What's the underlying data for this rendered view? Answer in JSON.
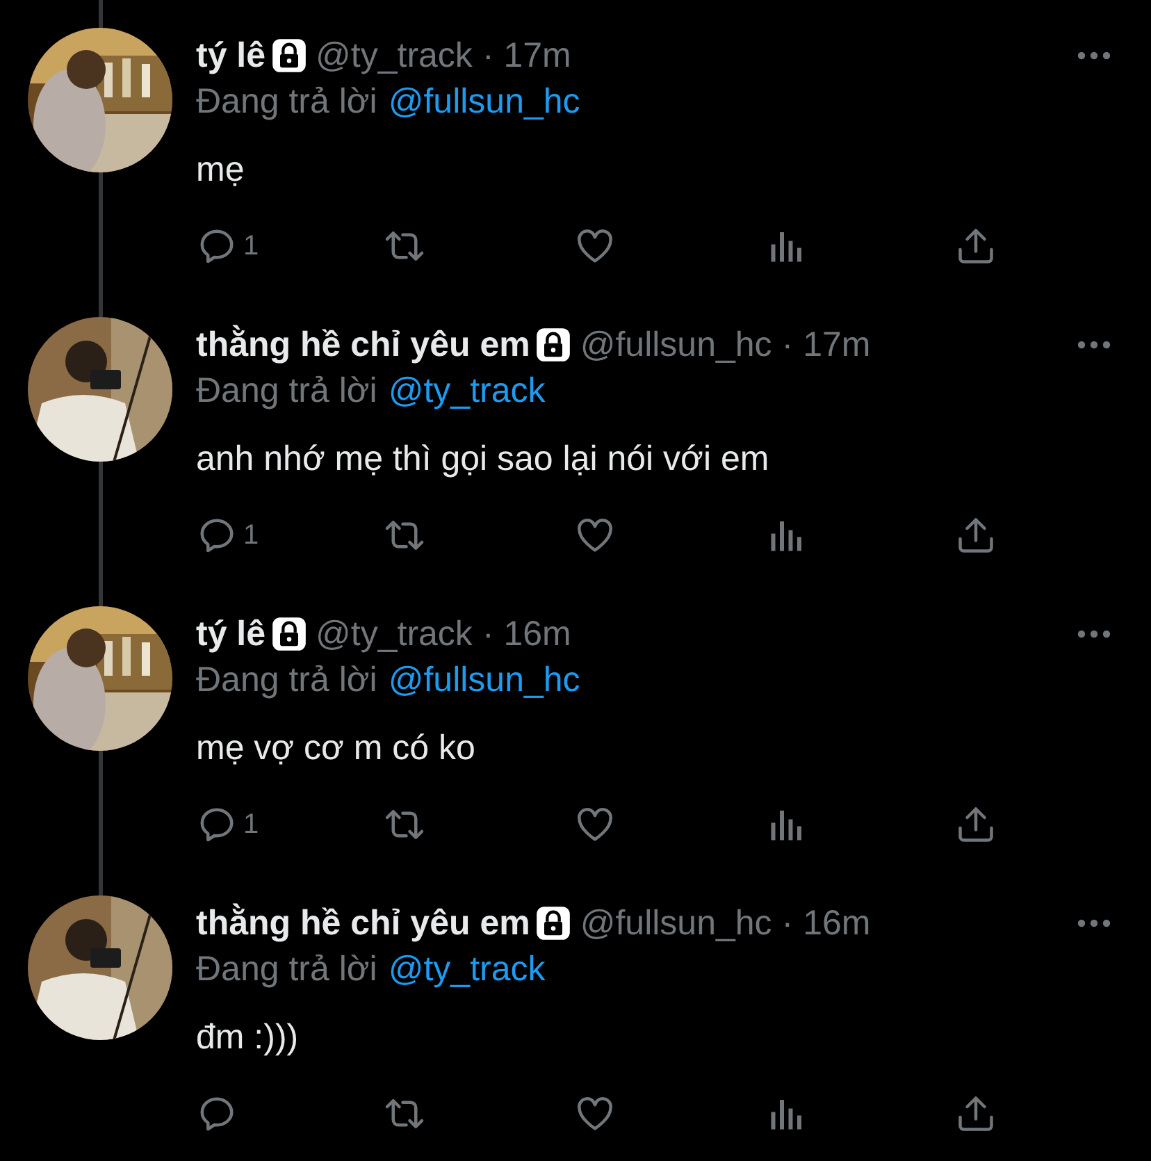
{
  "tweets": [
    {
      "name": "tý lê",
      "handle": "@ty_track",
      "time": "· 17m",
      "reply_prefix": "Đang trả lời",
      "reply_to": "@fullsun_hc",
      "text": "mẹ",
      "reply_count": "1",
      "protected": true
    },
    {
      "name": "thằng hề chỉ yêu em",
      "handle": "@fullsun_hc",
      "time": "· 17m",
      "reply_prefix": "Đang trả lời",
      "reply_to": "@ty_track",
      "text": "anh nhớ mẹ thì gọi sao lại nói với em",
      "reply_count": "1",
      "protected": true
    },
    {
      "name": "tý lê",
      "handle": "@ty_track",
      "time": "· 16m",
      "reply_prefix": "Đang trả lời",
      "reply_to": "@fullsun_hc",
      "text": "mẹ vợ cơ m có ko",
      "reply_count": "1",
      "protected": true
    },
    {
      "name": "thằng hề chỉ yêu em",
      "handle": "@fullsun_hc",
      "time": "· 16m",
      "reply_prefix": "Đang trả lời",
      "reply_to": "@ty_track",
      "text": "đm :)))",
      "protected": true
    }
  ]
}
